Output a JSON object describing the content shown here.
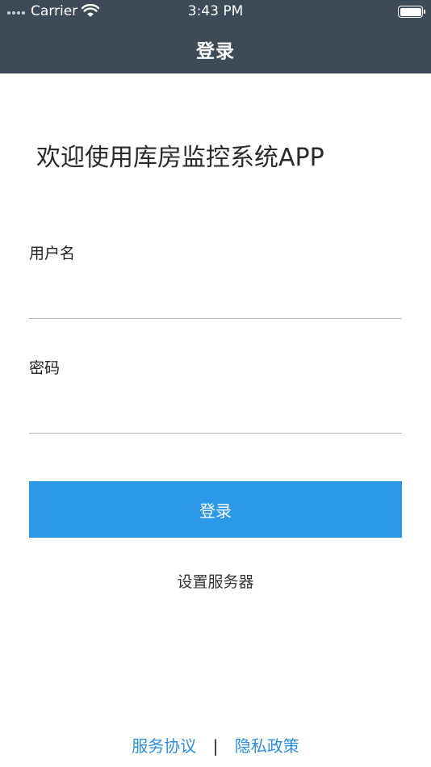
{
  "status_bar": {
    "carrier": "Carrier",
    "time": "3:43 PM",
    "wifi_icon": "wifi-icon",
    "battery_icon": "battery-full-icon",
    "background": "#3d4a57"
  },
  "nav": {
    "title": "登录",
    "background": "#3d4a57"
  },
  "welcome": "欢迎使用库房监控系统APP",
  "form": {
    "username_label": "用户名",
    "username_value": "",
    "password_label": "密码",
    "password_value": "",
    "login_label": "登录",
    "login_color": "#2b99e8"
  },
  "server_settings": "设置服务器",
  "footer": {
    "service_agreement": "服务协议",
    "separator": "|",
    "privacy_policy": "隐私政策",
    "link_color": "#2b8fe0"
  }
}
